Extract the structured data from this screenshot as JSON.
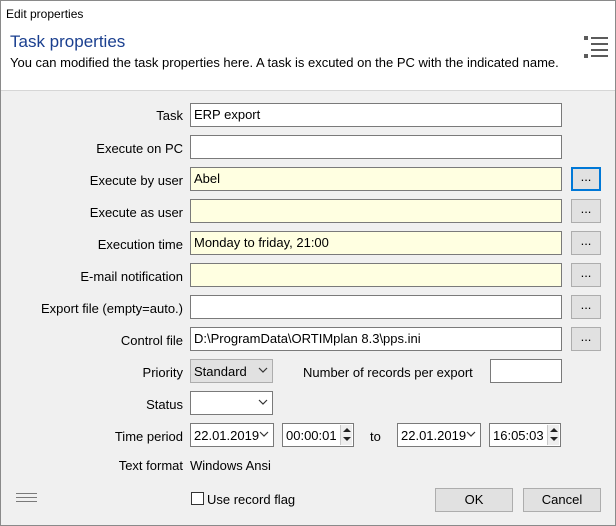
{
  "window": {
    "title": "Edit properties"
  },
  "header": {
    "title": "Task properties",
    "description": "You can modified the task properties here. A task is excuted on the PC with the indicated name.",
    "icon": "list-icon"
  },
  "fields": {
    "task": {
      "label": "Task",
      "value": "ERP export"
    },
    "execute_on_pc": {
      "label": "Execute on PC",
      "value": ""
    },
    "execute_by_user": {
      "label": "Execute by user",
      "value": "Abel"
    },
    "execute_as_user": {
      "label": "Execute as user",
      "value": ""
    },
    "execution_time": {
      "label": "Execution time",
      "value": "Monday to friday, 21:00"
    },
    "email_notification": {
      "label": "E-mail notification",
      "value": ""
    },
    "export_file": {
      "label": "Export file (empty=auto.)",
      "value": ""
    },
    "control_file": {
      "label": "Control file",
      "value": "D:\\ProgramData\\ORTIMplan 8.3\\pps.ini"
    }
  },
  "browse_label": "...",
  "priority": {
    "label": "Priority",
    "value": "Standard"
  },
  "records_per_export": {
    "label": "Number of records per export",
    "value": ""
  },
  "status": {
    "label": "Status",
    "value": ""
  },
  "time_period": {
    "label": "Time period",
    "from_date": "22.01.2019",
    "from_time": "00:00:01",
    "to_label": "to",
    "to_date": "22.01.2019",
    "to_time": "16:05:03"
  },
  "text_format": {
    "label": "Text format",
    "value": "Windows Ansi"
  },
  "use_record_flag": {
    "label": "Use record flag",
    "checked": false
  },
  "buttons": {
    "ok": "OK",
    "cancel": "Cancel"
  },
  "colors": {
    "title_accent": "#1a3f8f",
    "highlight_field": "#ffffe1",
    "focus": "#0078d7"
  }
}
